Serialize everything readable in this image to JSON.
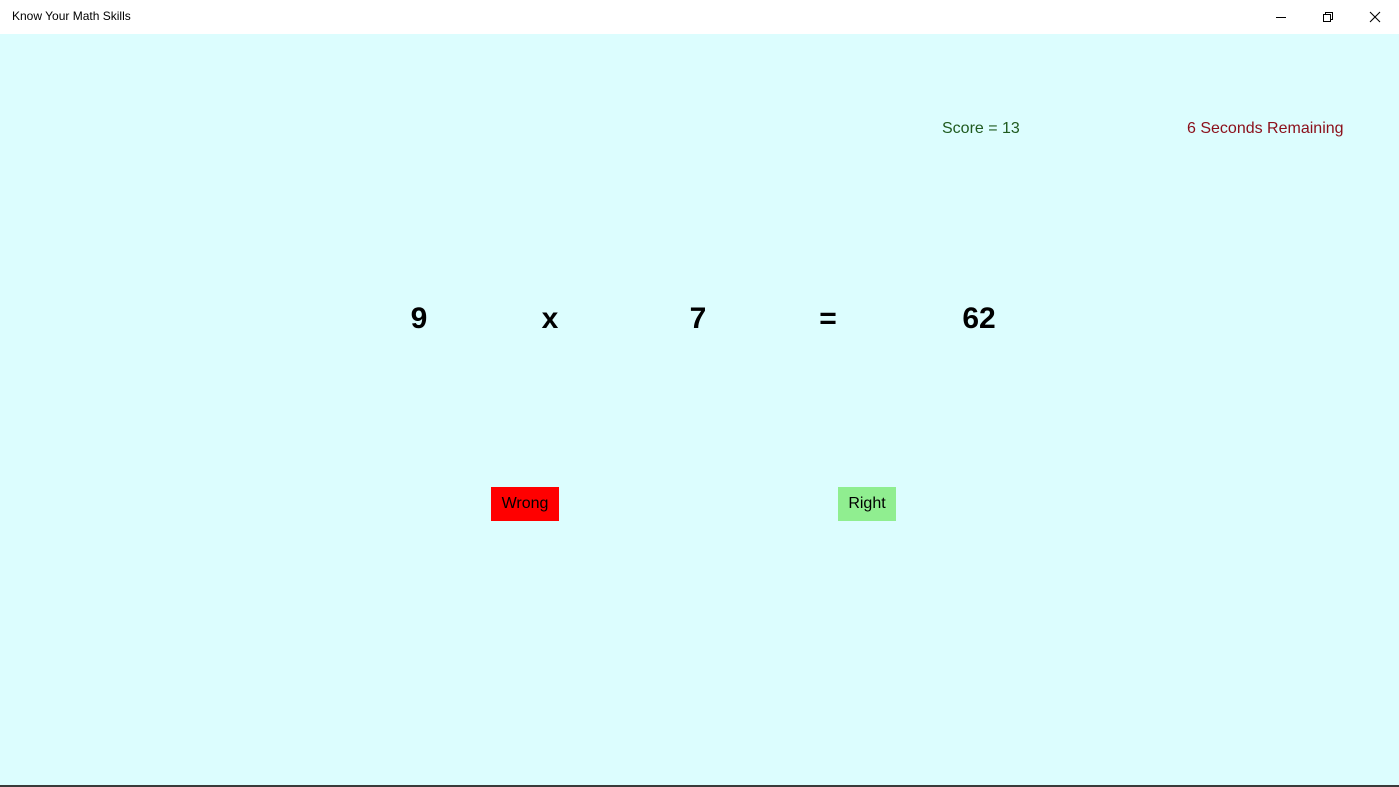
{
  "window": {
    "title": "Know Your Math Skills",
    "controls": {
      "minimize_icon": "minimize-icon",
      "restore_icon": "restore-icon",
      "close_icon": "close-icon"
    }
  },
  "status": {
    "score_text": "Score = 13",
    "timer_text": "6 Seconds Remaining"
  },
  "equation": {
    "operand_a": "9",
    "operator": "x",
    "operand_b": "7",
    "equals": "=",
    "result": "62"
  },
  "buttons": {
    "wrong_label": "Wrong",
    "right_label": "Right"
  },
  "colors": {
    "background": "#dcfdfe",
    "score_text": "#1f5a1f",
    "timer_text": "#8b0f1a",
    "wrong_button": "#ff0000",
    "right_button": "#90ee90"
  }
}
